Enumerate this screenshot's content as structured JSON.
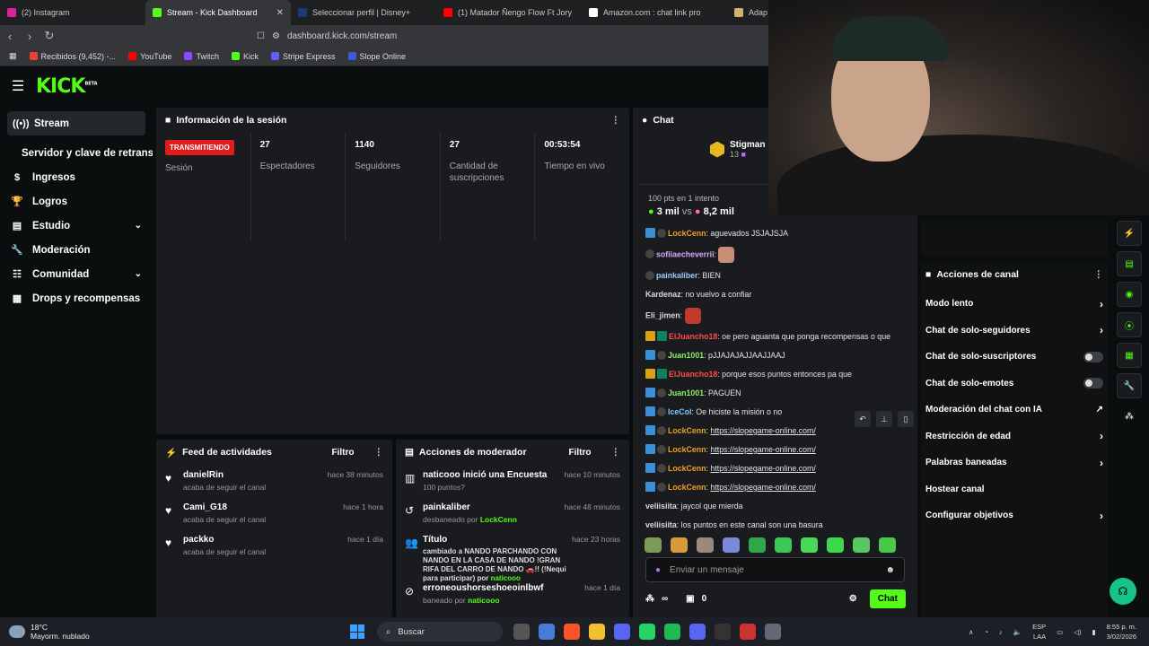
{
  "browser": {
    "tabs": [
      {
        "title": "(2) Instagram",
        "color": "#d6249f",
        "active": false
      },
      {
        "title": "Stream - Kick Dashboard",
        "color": "#53fc18",
        "active": true
      },
      {
        "title": "Seleccionar perfil | Disney+",
        "color": "#1a3a7a",
        "active": false
      },
      {
        "title": "(1) Matador Ñengo Flow Ft Jory",
        "color": "#ff0000",
        "active": false
      },
      {
        "title": "Amazon.com : chat link pro",
        "color": "#ffffff",
        "active": false
      },
      {
        "title": "Adap",
        "color": "#d4b26a",
        "active": false
      }
    ],
    "url": "dashboard.kick.com/stream",
    "bookmarks": [
      {
        "label": "Recibidos (9,452) -...",
        "color": "#ea4335"
      },
      {
        "label": "YouTube",
        "color": "#ff0000"
      },
      {
        "label": "Twitch",
        "color": "#9146ff"
      },
      {
        "label": "Kick",
        "color": "#53fc18"
      },
      {
        "label": "Stripe Express",
        "color": "#635bff"
      },
      {
        "label": "Slope Online",
        "color": "#3b5bdb"
      }
    ]
  },
  "brand": {
    "logo": "KICK",
    "beta": "BETA"
  },
  "sidebar": {
    "stream": "Stream",
    "sub": "Servidor y clave de retransmisión",
    "items": [
      {
        "label": "Ingresos",
        "icon": "$",
        "chev": false
      },
      {
        "label": "Logros",
        "icon": "🏆",
        "chev": false
      },
      {
        "label": "Estudio",
        "icon": "▤",
        "chev": true
      },
      {
        "label": "Moderación",
        "icon": "🔧",
        "chev": false
      },
      {
        "label": "Comunidad",
        "icon": "☷",
        "chev": true
      },
      {
        "label": "Drops y recompensas",
        "icon": "▦",
        "chev": false
      }
    ]
  },
  "session": {
    "title": "Información de la sesión",
    "badge": "TRANSMITIENDO",
    "badge_label": "Sesión",
    "stats": [
      {
        "value": "27",
        "label": "Espectadores"
      },
      {
        "value": "1140",
        "label": "Seguidores"
      },
      {
        "value": "27",
        "label": "Cantidad de suscripciones"
      },
      {
        "value": "00:53:54",
        "label": "Tiempo en vivo"
      }
    ]
  },
  "feed": {
    "title": "Feed de actividades",
    "filter": "Filtro",
    "rows": [
      {
        "name": "danielRin",
        "sub": "acaba de seguir el canal",
        "time": "hace 38 minutos"
      },
      {
        "name": "Cami_G18",
        "sub": "acaba de seguir el canal",
        "time": "hace 1 hora"
      },
      {
        "name": "packko",
        "sub": "acaba de seguir el canal",
        "time": "hace 1 día"
      }
    ]
  },
  "modactions": {
    "title": "Acciones de moderador",
    "filter": "Filtro",
    "rows": [
      {
        "icon": "▥",
        "name": "naticooo",
        "action": " inició una Encuesta",
        "sub": "100 puntos?",
        "time": "hace 10 minutos"
      },
      {
        "icon": "↺",
        "name": "painkaliber",
        "action": "",
        "sub": "desbaneado por ",
        "by": "LockCenn",
        "time": "hace 48 minutos"
      },
      {
        "icon": "👥",
        "name": "Título",
        "action": "",
        "sub": "cambiado a NANDO PARCHANDO CON NANDO EN LA CASA DE NANDO !GRAN RIFA DEL CARRO DE NANDO 🚗!! (!Nequi para participar) por ",
        "by": "naticooo",
        "time": "hace 23 horas"
      },
      {
        "icon": "⊘",
        "name": "erroneoushorseshoeoinlbwf",
        "action": "",
        "sub": "baneado por ",
        "by": "naticooo",
        "time": "hace 1 día"
      }
    ]
  },
  "chat": {
    "title": "Chat",
    "pinned_user": "Stigman",
    "pinned_count": "13",
    "poll_question": "100 pts en 1 intento",
    "poll_a": "3 mil",
    "poll_vs": "vs",
    "poll_b": "8,2 mil",
    "messages": [
      {
        "badges": [
          "v",
          "s"
        ],
        "user": "LockCenn",
        "color": "#f0a020",
        "text": "aguevados JSJAJSJA"
      },
      {
        "badges": [
          "s"
        ],
        "user": "sofiiaecheverrii",
        "color": "#d7a6ff",
        "text": "",
        "emote": "#c98f75"
      },
      {
        "badges": [
          "s"
        ],
        "user": "painkaliber",
        "color": "#9ec9ff",
        "text": "BIEN"
      },
      {
        "badges": [],
        "user": "Kardenaz",
        "color": "#d8d8d8",
        "text": "no vuelvo a confiar"
      },
      {
        "badges": [],
        "user": "Eli_jimen",
        "color": "#d8d8d8",
        "text": "",
        "emote": "#c23a2a"
      },
      {
        "badges": [
          "c",
          "g"
        ],
        "user": "ElJuancho18",
        "color": "#ff4b4b",
        "text": "oe pero aguanta que ponga recompensas o que"
      },
      {
        "badges": [
          "v",
          "s"
        ],
        "user": "Juan1001",
        "color": "#8ef06a",
        "text": "pJJAJAJAJJAAJJAAJ"
      },
      {
        "badges": [
          "c",
          "g"
        ],
        "user": "ElJuancho18",
        "color": "#ff4b4b",
        "text": "porque esos puntos entonces pa que"
      },
      {
        "badges": [
          "v",
          "s"
        ],
        "user": "Juan1001",
        "color": "#8ef06a",
        "text": "PAGUEN"
      },
      {
        "badges": [
          "v",
          "s"
        ],
        "user": "IceCol",
        "color": "#7fc8ff",
        "text": "Oe hiciste la misión o no"
      },
      {
        "badges": [
          "v",
          "s"
        ],
        "user": "LockCenn",
        "color": "#f0a020",
        "link": "https://slopegame-online.com/"
      },
      {
        "badges": [
          "v",
          "s"
        ],
        "user": "LockCenn",
        "color": "#f0a020",
        "link": "https://slopegame-online.com/"
      },
      {
        "badges": [
          "v",
          "s"
        ],
        "user": "LockCenn",
        "color": "#f0a020",
        "link": "https://slopegame-online.com/"
      },
      {
        "badges": [
          "v",
          "s"
        ],
        "user": "LockCenn",
        "color": "#f0a020",
        "link": "https://slopegame-online.com/"
      },
      {
        "badges": [],
        "user": "veliisiita",
        "color": "#d8d8d8",
        "text": "jaycol que mierda"
      },
      {
        "badges": [],
        "user": "veliisiita",
        "color": "#d8d8d8",
        "text": "los puntos en este canal son una basura"
      }
    ],
    "input_placeholder": "Enviar un mensaje",
    "points": "∞",
    "store_count": "0",
    "send_label": "Chat"
  },
  "channel_actions": {
    "title": "Acciones de canal",
    "items": [
      {
        "label": "Modo lento",
        "type": "chevron"
      },
      {
        "label": "Chat de solo-seguidores",
        "type": "chevron"
      },
      {
        "label": "Chat de solo-suscriptores",
        "type": "toggle"
      },
      {
        "label": "Chat de solo-emotes",
        "type": "toggle"
      },
      {
        "label": "Moderación del chat con IA",
        "type": "external"
      },
      {
        "label": "Restricción de edad",
        "type": "chevron"
      },
      {
        "label": "Palabras baneadas",
        "type": "chevron"
      },
      {
        "label": "Hostear canal",
        "type": "none"
      },
      {
        "label": "Configurar objetivos",
        "type": "chevron"
      }
    ]
  },
  "taskbar": {
    "temp": "18°C",
    "weather": "Mayorm. nublado",
    "search": "Buscar",
    "lang": "ESP",
    "lang2": "LAA",
    "time": "8:55 p. m.",
    "date": "3/02/2026"
  }
}
